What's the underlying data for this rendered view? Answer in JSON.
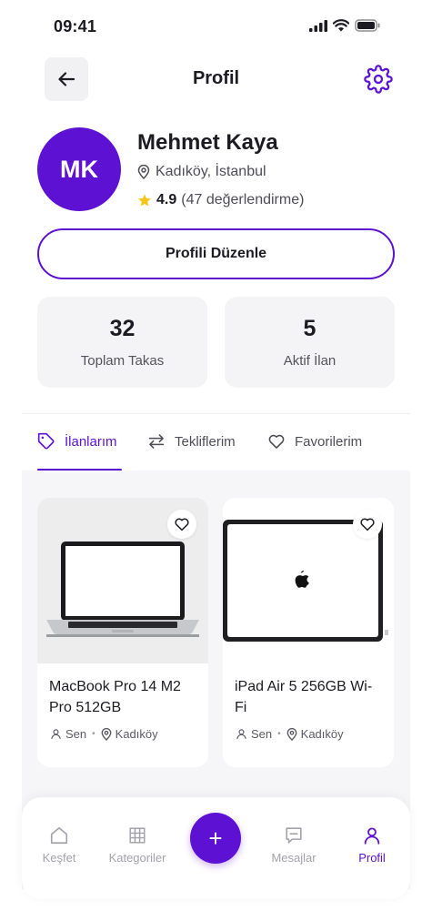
{
  "status_bar": {
    "time": "09:41"
  },
  "header": {
    "title": "Profil",
    "back_icon": "arrow-left-icon",
    "settings_icon": "gear-icon"
  },
  "profile": {
    "initials": "MK",
    "name": "Mehmet Kaya",
    "location": "Kadıköy, İstanbul",
    "rating": "4.9",
    "rating_count": "(47 değerlendirme)"
  },
  "edit_button": {
    "label": "Profili Düzenle"
  },
  "stats": [
    {
      "value": "32",
      "label": "Toplam Takas"
    },
    {
      "value": "5",
      "label": "Aktif İlan"
    }
  ],
  "tabs": [
    {
      "label": "İlanlarım",
      "icon": "tag-icon",
      "active": true
    },
    {
      "label": "Tekliflerim",
      "icon": "swap-icon",
      "active": false
    },
    {
      "label": "Favorilerim",
      "icon": "heart-icon",
      "active": false
    }
  ],
  "listings": [
    {
      "title": "MacBook Pro 14 M2 Pro 512GB",
      "owner": "Sen",
      "location": "Kadıköy"
    },
    {
      "title": "iPad Air 5 256GB Wi-Fi",
      "owner": "Sen",
      "location": "Kadıköy"
    }
  ],
  "bottom_nav": {
    "items": [
      {
        "label": "Keşfet",
        "icon": "home-icon"
      },
      {
        "label": "Kategoriler",
        "icon": "grid-icon"
      },
      {
        "label": "Mesajlar",
        "icon": "message-icon"
      },
      {
        "label": "Profil",
        "icon": "user-icon"
      }
    ],
    "add_label": "+"
  },
  "colors": {
    "accent": "#5d11d3",
    "star": "#f5c518",
    "card_bg": "#f4f4f6"
  }
}
